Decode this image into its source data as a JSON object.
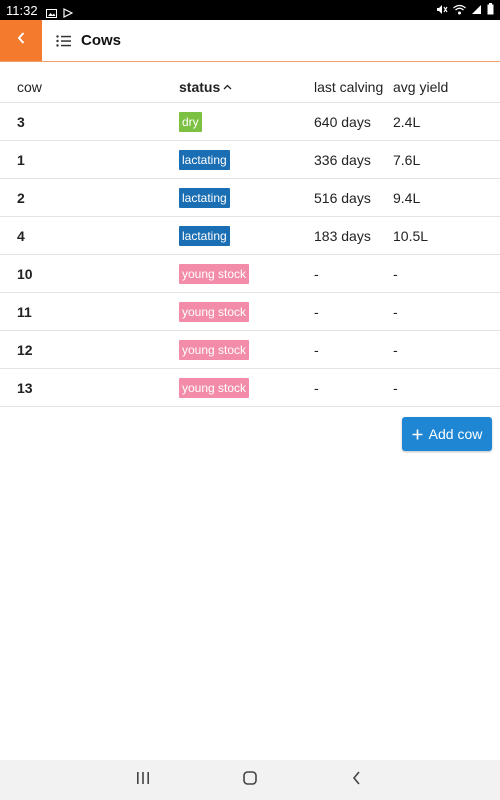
{
  "status_bar": {
    "time": "11:32"
  },
  "app_bar": {
    "title": "Cows"
  },
  "table": {
    "headers": {
      "cow": "cow",
      "status": "status",
      "last_calving": "last calving",
      "avg_yield": "avg yield"
    },
    "rows": [
      {
        "cow": "3",
        "status": "dry",
        "status_color": "#7cc142",
        "last_calving": "640 days",
        "avg_yield": "2.4L"
      },
      {
        "cow": "1",
        "status": "lactating",
        "status_color": "#1a6eb3",
        "last_calving": "336 days",
        "avg_yield": "7.6L"
      },
      {
        "cow": "2",
        "status": "lactating",
        "status_color": "#1a6eb3",
        "last_calving": "516 days",
        "avg_yield": "9.4L"
      },
      {
        "cow": "4",
        "status": "lactating",
        "status_color": "#1a6eb3",
        "last_calving": "183 days",
        "avg_yield": "10.5L"
      },
      {
        "cow": "10",
        "status": "young stock",
        "status_color": "#f38ca9",
        "last_calving": "-",
        "avg_yield": "-"
      },
      {
        "cow": "11",
        "status": "young stock",
        "status_color": "#f38ca9",
        "last_calving": "-",
        "avg_yield": "-"
      },
      {
        "cow": "12",
        "status": "young stock",
        "status_color": "#f38ca9",
        "last_calving": "-",
        "avg_yield": "-"
      },
      {
        "cow": "13",
        "status": "young stock",
        "status_color": "#f38ca9",
        "last_calving": "-",
        "avg_yield": "-"
      }
    ]
  },
  "actions": {
    "add_cow_label": "Add cow"
  },
  "colors": {
    "accent": "#f47a2d",
    "primary": "#1f86d4"
  },
  "icons": [
    "image-icon",
    "play-store-icon",
    "mute-icon",
    "wifi-icon",
    "signal-icon",
    "battery-icon",
    "back-arrow-icon",
    "list-icon",
    "sort-ascending-icon",
    "plus-icon",
    "recents-icon",
    "home-icon",
    "nav-back-icon"
  ]
}
